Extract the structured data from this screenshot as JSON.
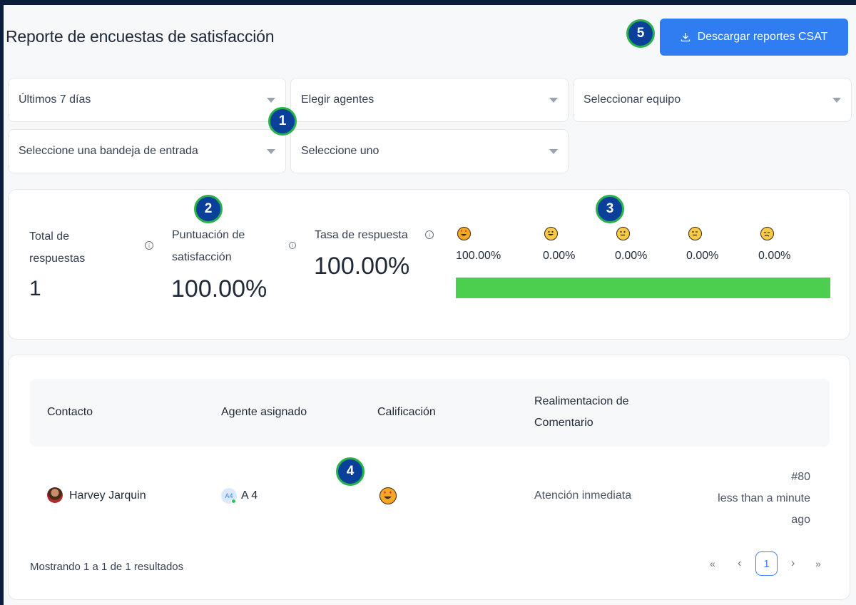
{
  "header": {
    "title": "Reporte de encuestas de satisfacción",
    "download_label": "Descargar reportes CSAT"
  },
  "filters": [
    {
      "value": "Últimos 7 días"
    },
    {
      "value": "Elegir agentes"
    },
    {
      "value": "Seleccionar equipo"
    },
    {
      "value": "Seleccione una bandeja de entrada"
    },
    {
      "value": "Seleccione uno"
    }
  ],
  "badges": [
    "1",
    "2",
    "3",
    "4",
    "5"
  ],
  "metrics": {
    "total_label_1": "Total de",
    "total_label_2": "respuestas",
    "total_value": "1",
    "score_label_1": "Puntuación de",
    "score_label_2": "satisfacción",
    "score_value": "100.00%",
    "rate_label": "Tasa de respuesta",
    "rate_value": "100.00%",
    "info_icon": "info-icon"
  },
  "distribution": {
    "ratings": [
      {
        "icon": "star-struck-emoji",
        "color": "#f59e0b",
        "percent": "100.00%"
      },
      {
        "icon": "grinning-emoji",
        "color": "#f7c948",
        "percent": "0.00%"
      },
      {
        "icon": "neutral-emoji",
        "color": "#f7c948",
        "percent": "0.00%"
      },
      {
        "icon": "expressionless-emoji",
        "color": "#f7c948",
        "percent": "0.00%"
      },
      {
        "icon": "disappointed-emoji",
        "color": "#f7c948",
        "percent": "0.00%"
      }
    ],
    "bar_fill_fraction": 1.0,
    "bar_color": "#4ccf4f"
  },
  "table": {
    "columns": [
      "Contacto",
      "Agente asignado",
      "Calificación",
      "Realimentacion de",
      "Comentario"
    ],
    "rows": [
      {
        "contact": "Harvey Jarquin",
        "agent_initials": "A4",
        "agent": "A 4",
        "rating_icon": "star-struck-emoji",
        "feedback": "Atención inmediata",
        "conversation": "#80",
        "time_1": "less than a minute",
        "time_2": "ago"
      }
    ]
  },
  "pagination": {
    "summary": "Mostrando 1 a 1 de 1 resultados",
    "first": "«",
    "prev": "‹",
    "current": "1",
    "next": "›",
    "last": "»"
  },
  "colors": {
    "accent": "#2f7df1",
    "badge_fill": "#0a3f9a",
    "badge_ring": "#28b34a"
  }
}
